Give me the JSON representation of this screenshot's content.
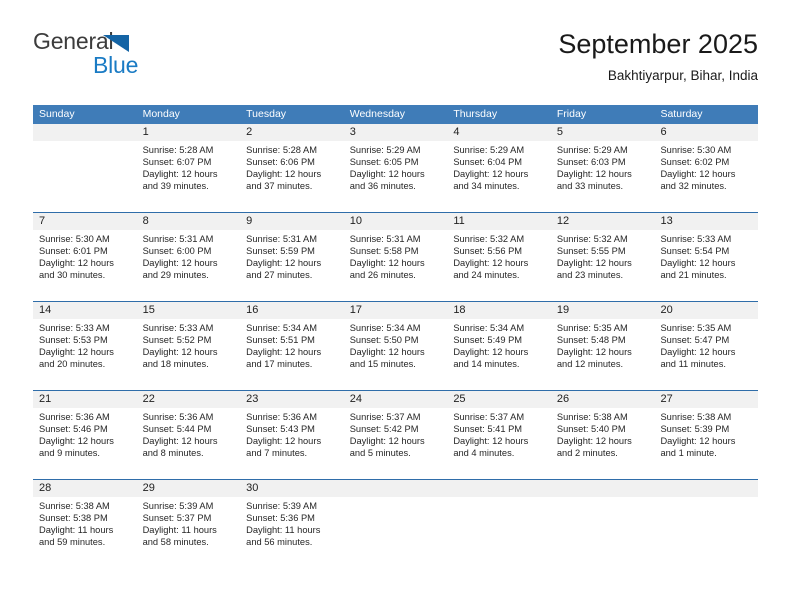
{
  "brand": {
    "name_top": "General",
    "name_bottom": "Blue",
    "triangle_color": "#1464a5",
    "blue_color": "#1a7bc4"
  },
  "header": {
    "title": "September 2025",
    "subtitle": "Bakhtiyarpur, Bihar, India"
  },
  "theme": {
    "header_blue": "#3f7cb8",
    "row_divider_blue": "#2f6da9",
    "daynum_band": "#f1f1f1"
  },
  "weekdays": [
    "Sunday",
    "Monday",
    "Tuesday",
    "Wednesday",
    "Thursday",
    "Friday",
    "Saturday"
  ],
  "weeks": [
    {
      "days": [
        {
          "num": "",
          "sunrise": "",
          "sunset": "",
          "daylight1": "",
          "daylight2": ""
        },
        {
          "num": "1",
          "sunrise": "Sunrise: 5:28 AM",
          "sunset": "Sunset: 6:07 PM",
          "daylight1": "Daylight: 12 hours",
          "daylight2": "and 39 minutes."
        },
        {
          "num": "2",
          "sunrise": "Sunrise: 5:28 AM",
          "sunset": "Sunset: 6:06 PM",
          "daylight1": "Daylight: 12 hours",
          "daylight2": "and 37 minutes."
        },
        {
          "num": "3",
          "sunrise": "Sunrise: 5:29 AM",
          "sunset": "Sunset: 6:05 PM",
          "daylight1": "Daylight: 12 hours",
          "daylight2": "and 36 minutes."
        },
        {
          "num": "4",
          "sunrise": "Sunrise: 5:29 AM",
          "sunset": "Sunset: 6:04 PM",
          "daylight1": "Daylight: 12 hours",
          "daylight2": "and 34 minutes."
        },
        {
          "num": "5",
          "sunrise": "Sunrise: 5:29 AM",
          "sunset": "Sunset: 6:03 PM",
          "daylight1": "Daylight: 12 hours",
          "daylight2": "and 33 minutes."
        },
        {
          "num": "6",
          "sunrise": "Sunrise: 5:30 AM",
          "sunset": "Sunset: 6:02 PM",
          "daylight1": "Daylight: 12 hours",
          "daylight2": "and 32 minutes."
        }
      ]
    },
    {
      "days": [
        {
          "num": "7",
          "sunrise": "Sunrise: 5:30 AM",
          "sunset": "Sunset: 6:01 PM",
          "daylight1": "Daylight: 12 hours",
          "daylight2": "and 30 minutes."
        },
        {
          "num": "8",
          "sunrise": "Sunrise: 5:31 AM",
          "sunset": "Sunset: 6:00 PM",
          "daylight1": "Daylight: 12 hours",
          "daylight2": "and 29 minutes."
        },
        {
          "num": "9",
          "sunrise": "Sunrise: 5:31 AM",
          "sunset": "Sunset: 5:59 PM",
          "daylight1": "Daylight: 12 hours",
          "daylight2": "and 27 minutes."
        },
        {
          "num": "10",
          "sunrise": "Sunrise: 5:31 AM",
          "sunset": "Sunset: 5:58 PM",
          "daylight1": "Daylight: 12 hours",
          "daylight2": "and 26 minutes."
        },
        {
          "num": "11",
          "sunrise": "Sunrise: 5:32 AM",
          "sunset": "Sunset: 5:56 PM",
          "daylight1": "Daylight: 12 hours",
          "daylight2": "and 24 minutes."
        },
        {
          "num": "12",
          "sunrise": "Sunrise: 5:32 AM",
          "sunset": "Sunset: 5:55 PM",
          "daylight1": "Daylight: 12 hours",
          "daylight2": "and 23 minutes."
        },
        {
          "num": "13",
          "sunrise": "Sunrise: 5:33 AM",
          "sunset": "Sunset: 5:54 PM",
          "daylight1": "Daylight: 12 hours",
          "daylight2": "and 21 minutes."
        }
      ]
    },
    {
      "days": [
        {
          "num": "14",
          "sunrise": "Sunrise: 5:33 AM",
          "sunset": "Sunset: 5:53 PM",
          "daylight1": "Daylight: 12 hours",
          "daylight2": "and 20 minutes."
        },
        {
          "num": "15",
          "sunrise": "Sunrise: 5:33 AM",
          "sunset": "Sunset: 5:52 PM",
          "daylight1": "Daylight: 12 hours",
          "daylight2": "and 18 minutes."
        },
        {
          "num": "16",
          "sunrise": "Sunrise: 5:34 AM",
          "sunset": "Sunset: 5:51 PM",
          "daylight1": "Daylight: 12 hours",
          "daylight2": "and 17 minutes."
        },
        {
          "num": "17",
          "sunrise": "Sunrise: 5:34 AM",
          "sunset": "Sunset: 5:50 PM",
          "daylight1": "Daylight: 12 hours",
          "daylight2": "and 15 minutes."
        },
        {
          "num": "18",
          "sunrise": "Sunrise: 5:34 AM",
          "sunset": "Sunset: 5:49 PM",
          "daylight1": "Daylight: 12 hours",
          "daylight2": "and 14 minutes."
        },
        {
          "num": "19",
          "sunrise": "Sunrise: 5:35 AM",
          "sunset": "Sunset: 5:48 PM",
          "daylight1": "Daylight: 12 hours",
          "daylight2": "and 12 minutes."
        },
        {
          "num": "20",
          "sunrise": "Sunrise: 5:35 AM",
          "sunset": "Sunset: 5:47 PM",
          "daylight1": "Daylight: 12 hours",
          "daylight2": "and 11 minutes."
        }
      ]
    },
    {
      "days": [
        {
          "num": "21",
          "sunrise": "Sunrise: 5:36 AM",
          "sunset": "Sunset: 5:46 PM",
          "daylight1": "Daylight: 12 hours",
          "daylight2": "and 9 minutes."
        },
        {
          "num": "22",
          "sunrise": "Sunrise: 5:36 AM",
          "sunset": "Sunset: 5:44 PM",
          "daylight1": "Daylight: 12 hours",
          "daylight2": "and 8 minutes."
        },
        {
          "num": "23",
          "sunrise": "Sunrise: 5:36 AM",
          "sunset": "Sunset: 5:43 PM",
          "daylight1": "Daylight: 12 hours",
          "daylight2": "and 7 minutes."
        },
        {
          "num": "24",
          "sunrise": "Sunrise: 5:37 AM",
          "sunset": "Sunset: 5:42 PM",
          "daylight1": "Daylight: 12 hours",
          "daylight2": "and 5 minutes."
        },
        {
          "num": "25",
          "sunrise": "Sunrise: 5:37 AM",
          "sunset": "Sunset: 5:41 PM",
          "daylight1": "Daylight: 12 hours",
          "daylight2": "and 4 minutes."
        },
        {
          "num": "26",
          "sunrise": "Sunrise: 5:38 AM",
          "sunset": "Sunset: 5:40 PM",
          "daylight1": "Daylight: 12 hours",
          "daylight2": "and 2 minutes."
        },
        {
          "num": "27",
          "sunrise": "Sunrise: 5:38 AM",
          "sunset": "Sunset: 5:39 PM",
          "daylight1": "Daylight: 12 hours",
          "daylight2": "and 1 minute."
        }
      ]
    },
    {
      "days": [
        {
          "num": "28",
          "sunrise": "Sunrise: 5:38 AM",
          "sunset": "Sunset: 5:38 PM",
          "daylight1": "Daylight: 11 hours",
          "daylight2": "and 59 minutes."
        },
        {
          "num": "29",
          "sunrise": "Sunrise: 5:39 AM",
          "sunset": "Sunset: 5:37 PM",
          "daylight1": "Daylight: 11 hours",
          "daylight2": "and 58 minutes."
        },
        {
          "num": "30",
          "sunrise": "Sunrise: 5:39 AM",
          "sunset": "Sunset: 5:36 PM",
          "daylight1": "Daylight: 11 hours",
          "daylight2": "and 56 minutes."
        },
        {
          "num": "",
          "sunrise": "",
          "sunset": "",
          "daylight1": "",
          "daylight2": ""
        },
        {
          "num": "",
          "sunrise": "",
          "sunset": "",
          "daylight1": "",
          "daylight2": ""
        },
        {
          "num": "",
          "sunrise": "",
          "sunset": "",
          "daylight1": "",
          "daylight2": ""
        },
        {
          "num": "",
          "sunrise": "",
          "sunset": "",
          "daylight1": "",
          "daylight2": ""
        }
      ]
    }
  ]
}
